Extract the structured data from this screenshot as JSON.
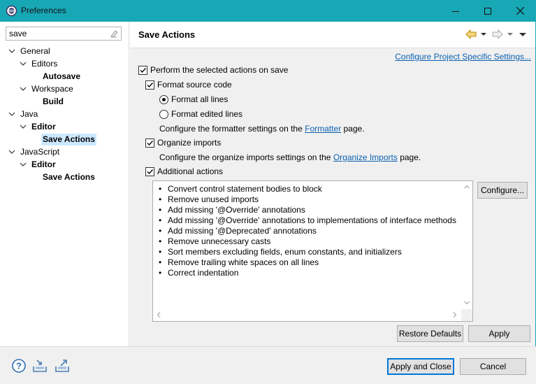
{
  "window": {
    "title": "Preferences"
  },
  "filter": {
    "value": "save"
  },
  "tree": [
    {
      "label": "General"
    },
    {
      "label": "Editors"
    },
    {
      "label": "Autosave"
    },
    {
      "label": "Workspace"
    },
    {
      "label": "Build"
    },
    {
      "label": "Java"
    },
    {
      "label": "Editor"
    },
    {
      "label": "Save Actions"
    },
    {
      "label": "JavaScript"
    },
    {
      "label": "Editor"
    },
    {
      "label": "Save Actions"
    }
  ],
  "page": {
    "title": "Save Actions",
    "configure_project_link": "Configure Project Specific Settings...",
    "perform_on_save": {
      "label": "Perform the selected actions on save",
      "checked": true
    },
    "format_source": {
      "label": "Format source code",
      "checked": true
    },
    "format_all": {
      "label": "Format all lines",
      "selected": true
    },
    "format_edited": {
      "label": "Format edited lines",
      "selected": false
    },
    "formatter_text_pre": "Configure the formatter settings on the ",
    "formatter_link": "Formatter",
    "formatter_text_post": " page.",
    "organize_imports": {
      "label": "Organize imports",
      "checked": true
    },
    "organize_text_pre": "Configure the organize imports settings on the ",
    "organize_link": "Organize Imports",
    "organize_text_post": " page.",
    "additional_actions": {
      "label": "Additional actions",
      "checked": true
    },
    "actions": [
      "Convert control statement bodies to block",
      "Remove unused imports",
      "Add missing '@Override' annotations",
      "Add missing '@Override' annotations to implementations of interface methods",
      "Add missing '@Deprecated' annotations",
      "Remove unnecessary casts",
      "Sort members excluding fields, enum constants, and initializers",
      "Remove trailing white spaces on all lines",
      "Correct indentation"
    ],
    "configure_button": "Configure...",
    "restore_defaults_button": "Restore Defaults",
    "apply_button": "Apply"
  },
  "footer": {
    "apply_and_close_button": "Apply and Close",
    "cancel_button": "Cancel"
  },
  "icons": {
    "app": "eclipse-icon",
    "help": "help-icon",
    "import": "import-icon",
    "export": "export-icon",
    "back": "back-arrow-icon",
    "forward": "forward-arrow-icon",
    "menu": "view-menu-icon"
  },
  "colors": {
    "titlebar": "#18a7b5",
    "selection": "#cce8ff",
    "link": "#0b61b1",
    "primary_border": "#0078d7"
  }
}
